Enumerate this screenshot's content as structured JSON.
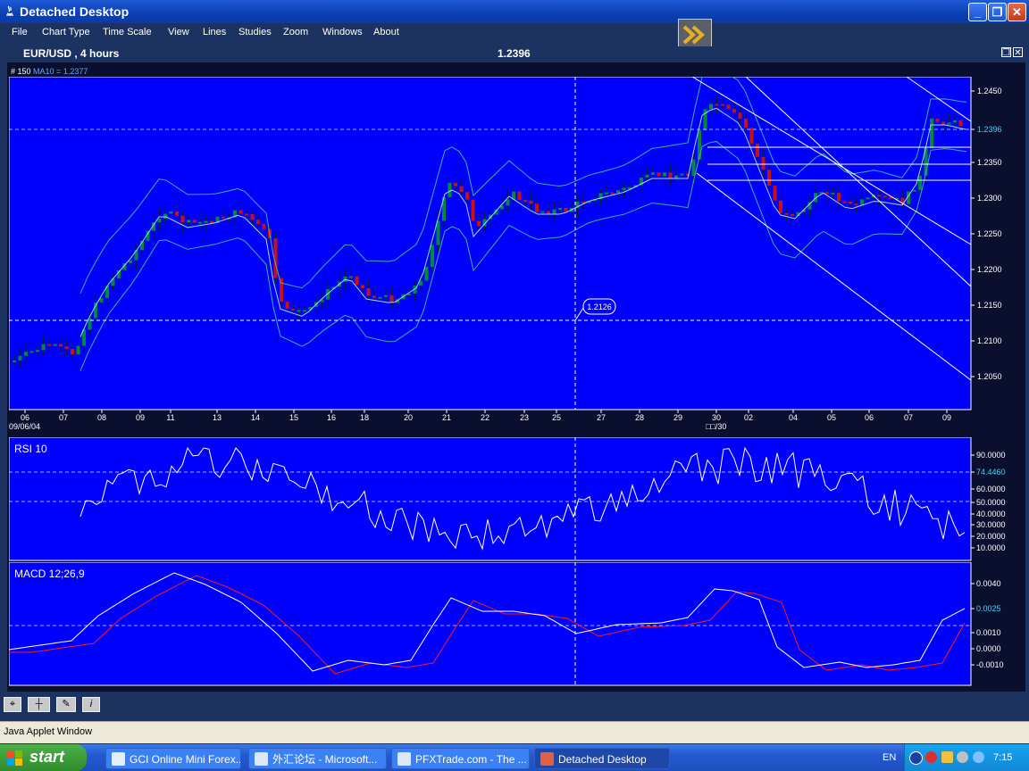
{
  "window": {
    "title": "Detached Desktop",
    "minimize_icon": "minimize-icon",
    "maximize_icon": "maximize-icon",
    "close_icon": "close-icon"
  },
  "menu": [
    "File",
    "Chart Type",
    "Time Scale",
    "View",
    "Lines",
    "Studies",
    "Zoom",
    "Windows",
    "About"
  ],
  "chart_header": {
    "symbol": "EUR/USD , 4 hours",
    "price": "1.2396"
  },
  "chart_info": {
    "bar_label": "# 150",
    "ma_label": "MA10 = 1.2377"
  },
  "price_chart": {
    "y_ticks": [
      "1.2450",
      "1.2396",
      "1.2350",
      "1.2300",
      "1.2250",
      "1.2200",
      "1.2150",
      "1.2100",
      "1.2050"
    ],
    "current_price": "1.2396",
    "crosshair_label": "1.2126",
    "x_ticks": [
      "06",
      "07",
      "08",
      "09",
      "11",
      "13",
      "14",
      "15",
      "16",
      "18",
      "20",
      "21",
      "22",
      "23",
      "25",
      "27",
      "28",
      "29",
      "30",
      "02",
      "04",
      "05",
      "06",
      "07",
      "09"
    ],
    "date_left": "09/06/04",
    "date_mid": "□□/30"
  },
  "rsi_panel": {
    "title": "RSI 10",
    "y_ticks": [
      "90.0000",
      "74.4460",
      "60.0000",
      "50.0000",
      "40.0000",
      "30.0000",
      "20.0000",
      "10.0000"
    ]
  },
  "macd_panel": {
    "title": "MACD 12;26,9",
    "y_ticks": [
      "0.0040",
      "0.0025",
      "0.0010",
      "0.0000",
      "-0.0010"
    ]
  },
  "colors": {
    "chart_bg": "#0000ff",
    "up_candle": "#008a3a",
    "down_candle": "#cc1010",
    "macd_line": "#ffffff",
    "signal_line": "#ff1a1a",
    "highlight_tick": "#44d0ff"
  },
  "status_bar": {
    "text": "Java Applet Window"
  },
  "taskbar": {
    "start": "start",
    "items": [
      "GCI Online Mini Forex...",
      "外汇论坛 - Microsoft...",
      "PFXTrade.com - The ...",
      "Detached Desktop"
    ],
    "language": "EN",
    "clock": "7:15"
  }
}
